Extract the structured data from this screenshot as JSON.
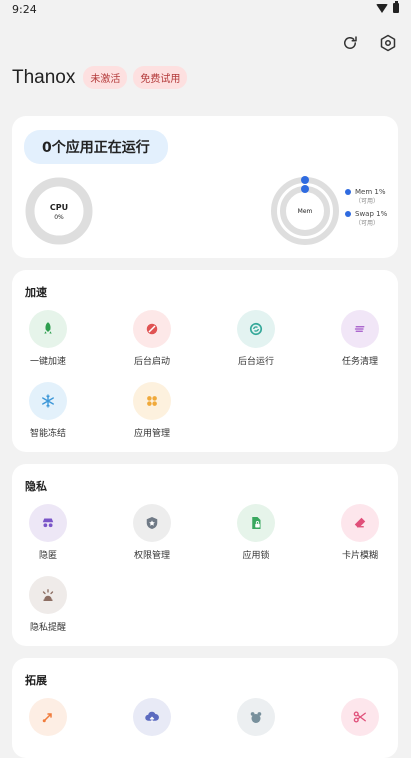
{
  "status_bar": {
    "time": "9:24"
  },
  "app": {
    "title": "Thanox",
    "badges": [
      "未激活",
      "免费试用"
    ]
  },
  "top_actions": {
    "refresh_icon": "refresh-icon",
    "settings_icon": "settings-icon"
  },
  "status": {
    "running": "0个应用正在运行",
    "cpu": {
      "label": "CPU",
      "value": "0%",
      "percent": 0
    },
    "mem": {
      "label": "Mem",
      "mem_percent": 1,
      "swap_percent": 1
    },
    "legend": [
      {
        "label": "Mem 1%",
        "sub": "（可用）"
      },
      {
        "label": "Swap 1%",
        "sub": "（可用）"
      }
    ]
  },
  "sections": [
    {
      "title": "加速",
      "items": [
        {
          "label": "一键加速",
          "icon": "rocket-icon",
          "bg": "#e6f4ea",
          "fg": "#2e9e4f"
        },
        {
          "label": "后台启动",
          "icon": "block-icon",
          "bg": "#fde8e8",
          "fg": "#e05353"
        },
        {
          "label": "后台运行",
          "icon": "sync-icon",
          "bg": "#e3f3f1",
          "fg": "#34a899"
        },
        {
          "label": "任务清理",
          "icon": "list-icon",
          "bg": "#f1e6f7",
          "fg": "#a256c8"
        },
        {
          "label": "智能冻结",
          "icon": "snowflake-icon",
          "bg": "#e3f1fb",
          "fg": "#3c97d8"
        },
        {
          "label": "应用管理",
          "icon": "apps-icon",
          "bg": "#fdf1de",
          "fg": "#f0a93a"
        }
      ]
    },
    {
      "title": "隐私",
      "items": [
        {
          "label": "隐匿",
          "icon": "incognito-icon",
          "bg": "#ede7f6",
          "fg": "#7a55c8"
        },
        {
          "label": "权限管理",
          "icon": "shield-icon",
          "bg": "#ededed",
          "fg": "#707a86"
        },
        {
          "label": "应用锁",
          "icon": "lock-file-icon",
          "bg": "#e6f4ea",
          "fg": "#3aa860"
        },
        {
          "label": "卡片模糊",
          "icon": "eraser-icon",
          "bg": "#fde6ec",
          "fg": "#e0507a"
        },
        {
          "label": "隐私提醒",
          "icon": "alarm-icon",
          "bg": "#efebe9",
          "fg": "#8d6e63"
        }
      ]
    },
    {
      "title": "拓展",
      "items": [
        {
          "label": "",
          "icon": "route-icon",
          "bg": "#fdeee4",
          "fg": "#f07a3a"
        },
        {
          "label": "",
          "icon": "cloud-upload-icon",
          "bg": "#e8eaf6",
          "fg": "#5c6bc0"
        },
        {
          "label": "",
          "icon": "bear-icon",
          "bg": "#eceff1",
          "fg": "#78909c"
        },
        {
          "label": "",
          "icon": "scissors-icon",
          "bg": "#fde6ec",
          "fg": "#e0507a"
        }
      ]
    }
  ],
  "colors": {
    "accent_blue": "#2f6be0",
    "gauge_gray": "#e0e0e0"
  }
}
